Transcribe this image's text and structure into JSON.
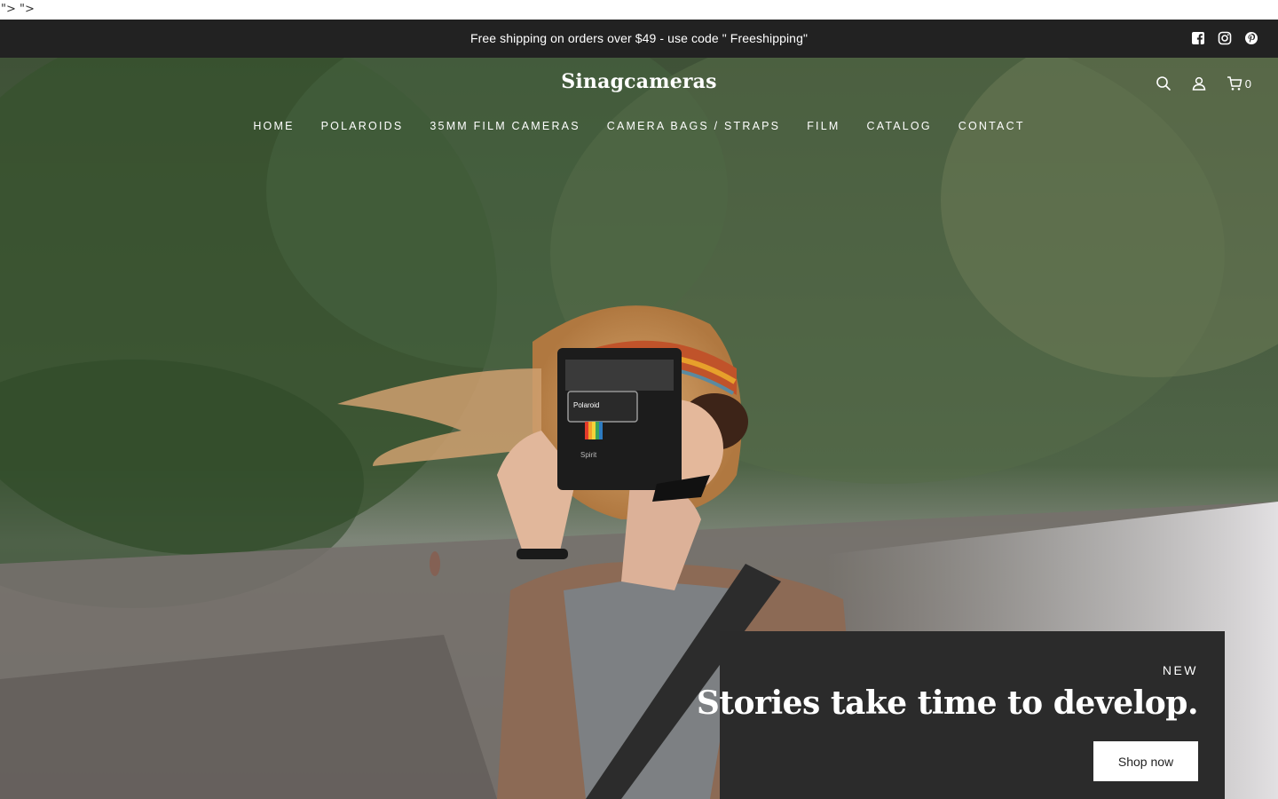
{
  "stray_text": "\"> \">",
  "announcement": {
    "text": "Free shipping on orders over $49 - use code \" Freeshipping\"",
    "social_icons": [
      "facebook-icon",
      "instagram-icon",
      "pinterest-icon"
    ]
  },
  "header": {
    "logo": "Sinagcameras",
    "icons": [
      "search-icon",
      "account-icon",
      "cart-icon"
    ],
    "cart_count": "0"
  },
  "nav": {
    "items": [
      {
        "label": "HOME"
      },
      {
        "label": "POLAROIDS"
      },
      {
        "label": "35MM FILM CAMERAS"
      },
      {
        "label": "CAMERA BAGS / STRAPS"
      },
      {
        "label": "FILM"
      },
      {
        "label": "CATALOG"
      },
      {
        "label": "CONTACT"
      }
    ]
  },
  "hero": {
    "image_camera_brand": "Polaroid",
    "image_camera_model": "Spirit",
    "promo": {
      "eyebrow": "NEW",
      "heading": "Stories take time to develop.",
      "button_label": "Shop now"
    }
  },
  "colors": {
    "announcement_bg": "#222222",
    "promo_bg": "#2b2b2b",
    "button_bg": "#ffffff",
    "text_light": "#ffffff"
  }
}
